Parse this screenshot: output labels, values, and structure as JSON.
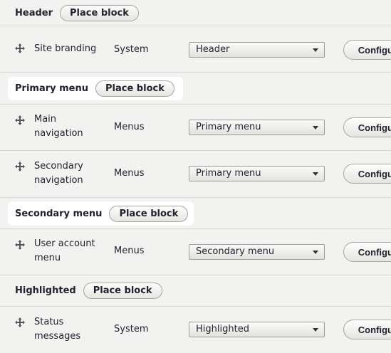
{
  "regions": {
    "header": {
      "title": "Header",
      "button": "Place block"
    },
    "primary_menu": {
      "title": "Primary menu",
      "button": "Place block"
    },
    "secondary_menu": {
      "title": "Secondary menu",
      "button": "Place block"
    },
    "highlighted": {
      "title": "Highlighted",
      "button": "Place block"
    }
  },
  "blocks": {
    "site_branding": {
      "name": "Site branding",
      "category": "System",
      "region": "Header",
      "button": "Configure"
    },
    "main_navigation": {
      "name": "Main navigation",
      "category": "Menus",
      "region": "Primary menu",
      "button": "Configure"
    },
    "secondary_navigation": {
      "name": "Secondary navigation",
      "category": "Menus",
      "region": "Primary menu",
      "button": "Configure"
    },
    "user_account_menu": {
      "name": "User account menu",
      "category": "Menus",
      "region": "Secondary menu",
      "button": "Configure"
    },
    "status_messages": {
      "name": "Status messages",
      "category": "System",
      "region": "Highlighted",
      "button": "Configure"
    }
  },
  "icons": {
    "drag_handle": "move-cross-icon",
    "select_arrow": "chevron-down-icon"
  }
}
